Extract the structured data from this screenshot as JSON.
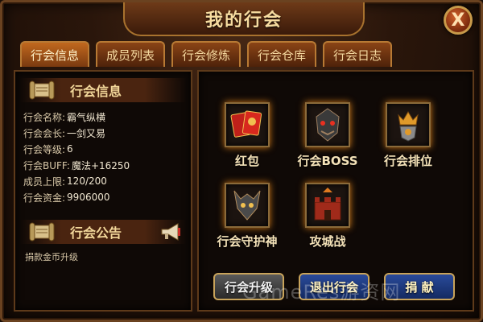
{
  "window": {
    "title": "我的行会",
    "close_label": "X"
  },
  "tabs": [
    {
      "label": "行会信息",
      "active": true
    },
    {
      "label": "成员列表"
    },
    {
      "label": "行会修炼"
    },
    {
      "label": "行会仓库"
    },
    {
      "label": "行会日志"
    }
  ],
  "info": {
    "header": "行会信息",
    "rows": [
      {
        "label": "行会名称:",
        "value": "霸气纵横"
      },
      {
        "label": "行会会长:",
        "value": "一剑又易"
      },
      {
        "label": "行会等级:",
        "value": "6"
      },
      {
        "label": "行会BUFF:",
        "value": "魔法+16250"
      },
      {
        "label": "成员上限:",
        "value": "120/200"
      },
      {
        "label": "行会资金:",
        "value": "9906000"
      }
    ]
  },
  "notice": {
    "header": "行会公告",
    "text": "捐款金币升级"
  },
  "features": [
    {
      "label": "红包",
      "icon": "red-envelope-icon"
    },
    {
      "label": "行会BOSS",
      "icon": "boss-icon"
    },
    {
      "label": "行会排位",
      "icon": "ranking-icon"
    },
    {
      "label": "行会守护神",
      "icon": "guardian-icon"
    },
    {
      "label": "攻城战",
      "icon": "siege-icon"
    }
  ],
  "buttons": {
    "upgrade": "行会升级",
    "quit": "退出行会",
    "donate": "捐 献"
  },
  "watermark": "GameRes游资网",
  "colors": {
    "accent_gold": "#f2d79a",
    "glow": "#d27a1a",
    "button_blue": "#2a4a9a"
  }
}
